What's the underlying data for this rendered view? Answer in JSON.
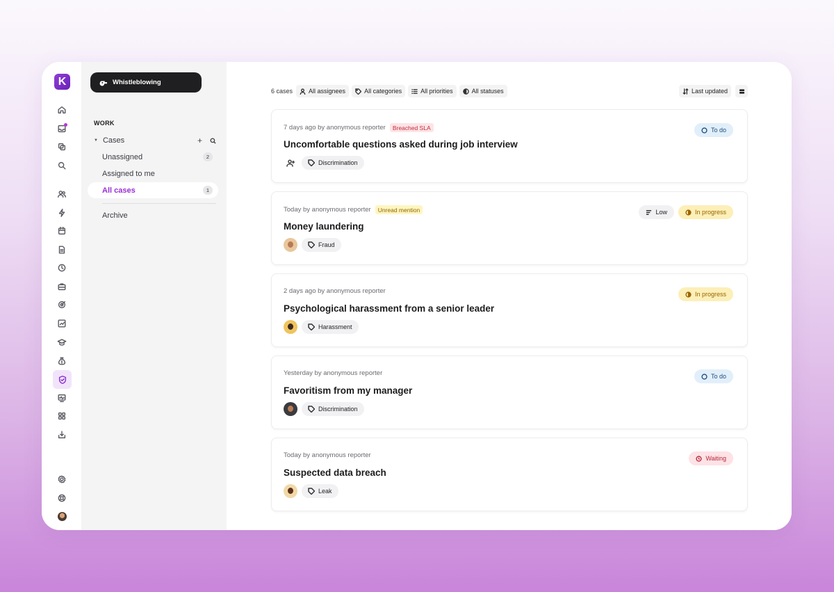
{
  "app": {
    "logo_letter": "K",
    "module_label": "Whistleblowing",
    "brand_color": "#8a2fd0"
  },
  "sidebar": {
    "section_label": "WORK",
    "cases_label": "Cases",
    "items": [
      {
        "label": "Unassigned",
        "count": "2"
      },
      {
        "label": "Assigned to me",
        "count": ""
      },
      {
        "label": "All cases",
        "count": "1"
      },
      {
        "label": "Archive",
        "count": ""
      }
    ]
  },
  "rail": {
    "icons": [
      "home-icon",
      "inbox-icon",
      "integrations-icon",
      "search-icon",
      "people-icon",
      "bolt-icon",
      "calendar-icon",
      "document-icon",
      "clock-icon",
      "team-icon",
      "goals-icon",
      "analytics-icon",
      "learning-icon",
      "payroll-icon",
      "shield-check-icon",
      "wellbeing-icon",
      "apps-grid-icon",
      "download-icon",
      "settings-icon",
      "help-icon",
      "user-avatar"
    ],
    "active": "shield-check-icon"
  },
  "toolbar": {
    "case_count": "6 cases",
    "filters": [
      "All assignees",
      "All categories",
      "All priorities",
      "All statuses"
    ],
    "sort_label": "Last updated"
  },
  "cases": [
    {
      "meta": "7 days ago by anonymous reporter",
      "badge": "Breached SLA",
      "title": "Uncomfortable questions asked during job interview",
      "category": "Discrimination",
      "status": "To do",
      "priority": ""
    },
    {
      "meta": "Today by anonymous reporter",
      "badge": "Unread mention",
      "title": "Money laundering",
      "category": "Fraud",
      "status": "In progress",
      "priority": "Low"
    },
    {
      "meta": "2 days ago by anonymous reporter",
      "badge": "",
      "title": "Psychological harassment from a senior leader",
      "category": "Harassment",
      "status": "In progress",
      "priority": ""
    },
    {
      "meta": "Yesterday by anonymous reporter",
      "badge": "",
      "title": "Favoritism from my manager",
      "category": "Discrimination",
      "status": "To do",
      "priority": ""
    },
    {
      "meta": "Today by anonymous reporter",
      "badge": "",
      "title": "Suspected data breach",
      "category": "Leak",
      "status": "Waiting",
      "priority": ""
    }
  ]
}
